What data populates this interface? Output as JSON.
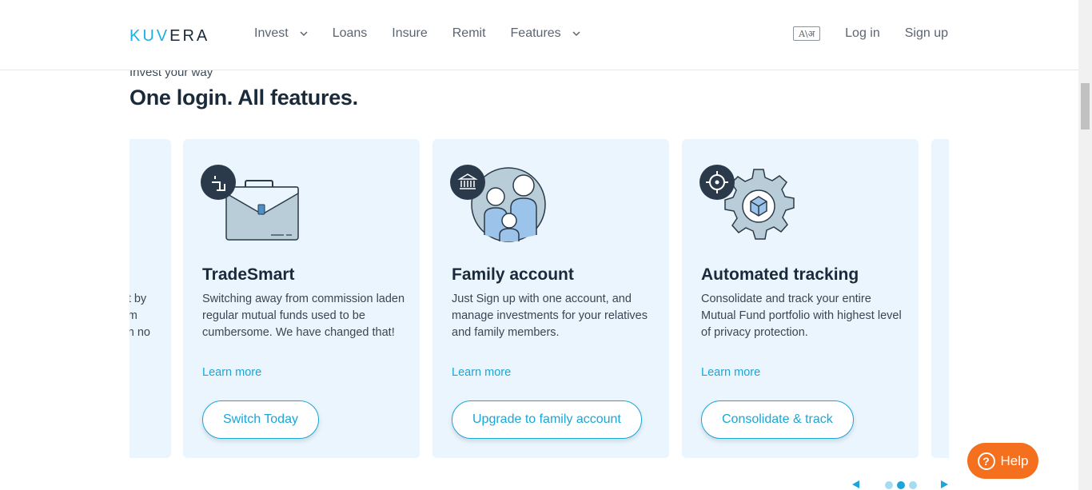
{
  "header": {
    "logo": "KUVERA",
    "nav": [
      {
        "label": "Invest",
        "has_dropdown": true
      },
      {
        "label": "Loans",
        "has_dropdown": false
      },
      {
        "label": "Insure",
        "has_dropdown": false
      },
      {
        "label": "Remit",
        "has_dropdown": false
      },
      {
        "label": "Features",
        "has_dropdown": true
      }
    ],
    "language_icon": "A\\अ",
    "login": "Log in",
    "signup": "Sign up"
  },
  "section": {
    "eyebrow": "Invest your way",
    "title": "One login. All features."
  },
  "partial_card_left": {
    "lines": [
      "t by",
      "m",
      "n no"
    ]
  },
  "cards": [
    {
      "title": "TradeSmart",
      "description": "Switching away from commission laden regular mutual funds used to be cumbersome. We have changed that!",
      "learn_more": "Learn more",
      "cta": "Switch Today",
      "icon": "briefcase-icon"
    },
    {
      "title": "Family account",
      "description": "Just Sign up with one account, and manage investments for your relatives and family members.",
      "learn_more": "Learn more",
      "cta": "Upgrade to family account",
      "icon": "family-icon"
    },
    {
      "title": "Automated tracking",
      "description": "Consolidate and track your entire Mutual Fund portfolio with highest level of privacy protection.",
      "learn_more": "Learn more",
      "cta": "Consolidate & track",
      "icon": "gear-icon"
    }
  ],
  "help": {
    "label": "Help",
    "icon": "question-icon"
  },
  "carousel": {
    "dots": 3,
    "active_index": 1
  },
  "colors": {
    "accent": "#1aa6d8",
    "card_bg": "#eaf5fd",
    "help_bg": "#f5701e",
    "title": "#1b2a3a"
  }
}
